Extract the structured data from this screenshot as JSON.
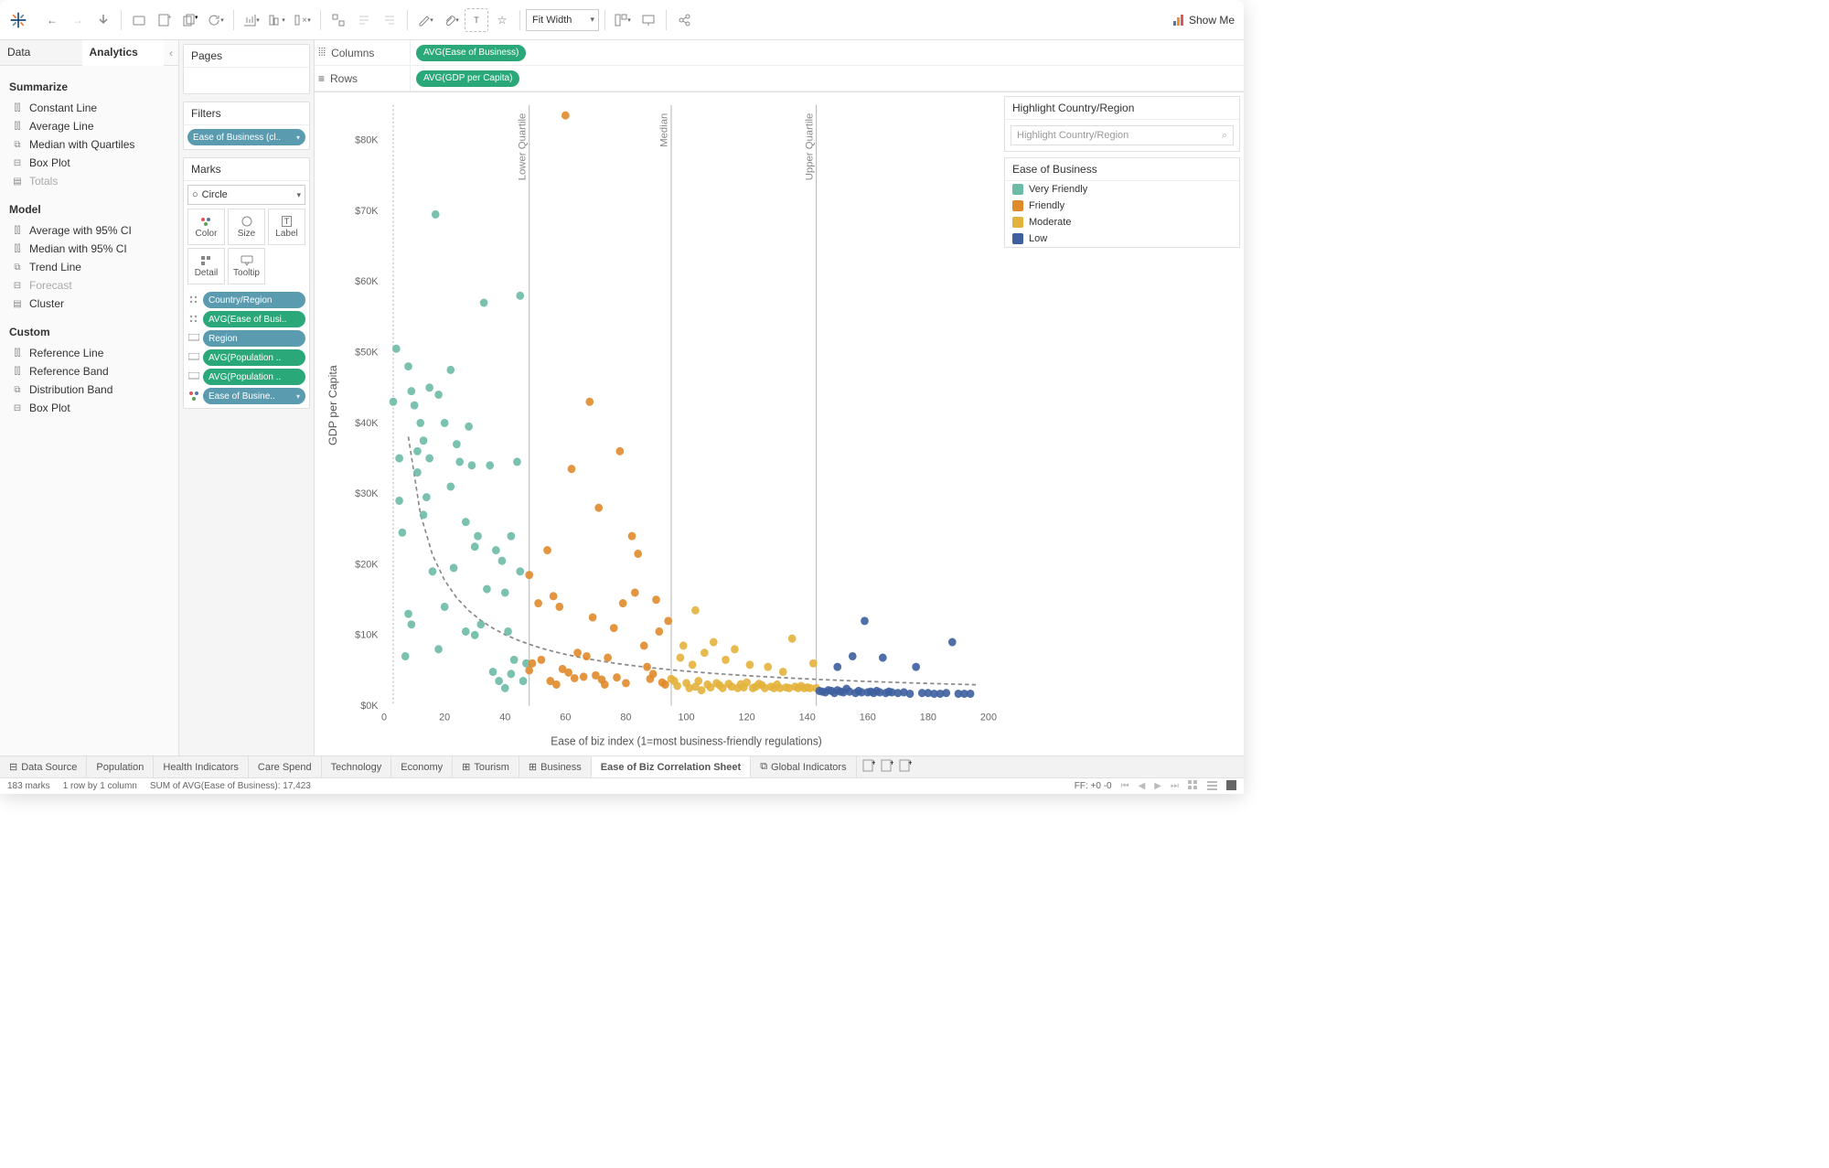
{
  "toolbar": {
    "fit_select": "Fit Width",
    "showme": "Show Me"
  },
  "left_tabs": {
    "data": "Data",
    "analytics": "Analytics"
  },
  "analytics": {
    "summarize": {
      "title": "Summarize",
      "items": [
        "Constant Line",
        "Average Line",
        "Median with Quartiles",
        "Box Plot",
        "Totals"
      ],
      "disabled": [
        4
      ]
    },
    "model": {
      "title": "Model",
      "items": [
        "Average with 95% CI",
        "Median with 95% CI",
        "Trend Line",
        "Forecast",
        "Cluster"
      ],
      "disabled": [
        3
      ]
    },
    "custom": {
      "title": "Custom",
      "items": [
        "Reference Line",
        "Reference Band",
        "Distribution Band",
        "Box Plot"
      ]
    }
  },
  "pages": {
    "title": "Pages"
  },
  "filters": {
    "title": "Filters",
    "pill": "Ease of Business (cl.."
  },
  "marks": {
    "title": "Marks",
    "type": "Circle",
    "cells": [
      "Color",
      "Size",
      "Label",
      "Detail",
      "Tooltip"
    ],
    "pills": [
      {
        "icon": "detail",
        "type": "dim",
        "label": "Country/Region"
      },
      {
        "icon": "detail",
        "type": "meas",
        "label": "AVG(Ease of Busi.."
      },
      {
        "icon": "tooltip",
        "type": "dim",
        "label": "Region"
      },
      {
        "icon": "tooltip",
        "type": "meas",
        "label": "AVG(Population .."
      },
      {
        "icon": "tooltip",
        "type": "meas",
        "label": "AVG(Population .."
      },
      {
        "icon": "color",
        "type": "dim",
        "label": "Ease of Busine.."
      }
    ]
  },
  "shelves": {
    "columns": {
      "label": "Columns",
      "pill": "AVG(Ease of Business)"
    },
    "rows": {
      "label": "Rows",
      "pill": "AVG(GDP per Capita)"
    }
  },
  "highlighter": {
    "title": "Highlight Country/Region",
    "placeholder": "Highlight Country/Region"
  },
  "legend": {
    "title": "Ease of Business",
    "items": [
      {
        "label": "Very Friendly",
        "color": "#6bbba6"
      },
      {
        "label": "Friendly",
        "color": "#e08a2a"
      },
      {
        "label": "Moderate",
        "color": "#e3b23c"
      },
      {
        "label": "Low",
        "color": "#3d5f9e"
      }
    ]
  },
  "chart_data": {
    "type": "scatter",
    "xlabel": "Ease of biz index (1=most business-friendly regulations)",
    "ylabel": "GDP per Capita",
    "xlim": [
      0,
      200
    ],
    "ylim": [
      0,
      85000
    ],
    "xticks": [
      0,
      20,
      40,
      60,
      80,
      100,
      120,
      140,
      160,
      180,
      200
    ],
    "yticks": [
      0,
      10000,
      20000,
      30000,
      40000,
      50000,
      60000,
      70000,
      80000
    ],
    "yticklabels": [
      "$0K",
      "$10K",
      "$20K",
      "$30K",
      "$40K",
      "$50K",
      "$60K",
      "$70K",
      "$80K"
    ],
    "ref_lines": [
      {
        "x": 48,
        "label": "Lower Quartile"
      },
      {
        "x": 95,
        "label": "Median"
      },
      {
        "x": 143,
        "label": "Upper Quartile"
      }
    ],
    "colors": {
      "Very Friendly": "#6bbba6",
      "Friendly": "#e08a2a",
      "Moderate": "#e3b23c",
      "Low": "#3d5f9e"
    },
    "series": [
      {
        "name": "Very Friendly",
        "points": [
          [
            3,
            43000
          ],
          [
            4,
            50500
          ],
          [
            5,
            29000
          ],
          [
            5,
            35000
          ],
          [
            6,
            24500
          ],
          [
            7,
            7000
          ],
          [
            8,
            13000
          ],
          [
            8,
            48000
          ],
          [
            9,
            11500
          ],
          [
            9,
            44500
          ],
          [
            10,
            42500
          ],
          [
            11,
            33000
          ],
          [
            11,
            36000
          ],
          [
            12,
            40000
          ],
          [
            13,
            37500
          ],
          [
            13,
            27000
          ],
          [
            14,
            29500
          ],
          [
            15,
            35000
          ],
          [
            15,
            45000
          ],
          [
            16,
            19000
          ],
          [
            17,
            69500
          ],
          [
            18,
            44000
          ],
          [
            18,
            8000
          ],
          [
            20,
            40000
          ],
          [
            20,
            14000
          ],
          [
            22,
            47500
          ],
          [
            22,
            31000
          ],
          [
            23,
            19500
          ],
          [
            24,
            37000
          ],
          [
            25,
            34500
          ],
          [
            27,
            26000
          ],
          [
            27,
            10500
          ],
          [
            28,
            39500
          ],
          [
            29,
            34000
          ],
          [
            30,
            10000
          ],
          [
            30,
            22500
          ],
          [
            31,
            24000
          ],
          [
            32,
            11500
          ],
          [
            33,
            57000
          ],
          [
            34,
            16500
          ],
          [
            35,
            34000
          ],
          [
            36,
            4800
          ],
          [
            37,
            22000
          ],
          [
            38,
            3500
          ],
          [
            39,
            20500
          ],
          [
            40,
            16000
          ],
          [
            40,
            2500
          ],
          [
            41,
            10500
          ],
          [
            42,
            4500
          ],
          [
            42,
            24000
          ],
          [
            43,
            6500
          ],
          [
            44,
            34500
          ],
          [
            45,
            58000
          ],
          [
            45,
            19000
          ],
          [
            46,
            3500
          ],
          [
            47,
            6000
          ]
        ]
      },
      {
        "name": "Friendly",
        "points": [
          [
            48,
            5000
          ],
          [
            48,
            18500
          ],
          [
            49,
            6000
          ],
          [
            51,
            14500
          ],
          [
            52,
            6500
          ],
          [
            54,
            22000
          ],
          [
            55,
            3500
          ],
          [
            56,
            15500
          ],
          [
            57,
            3000
          ],
          [
            58,
            14000
          ],
          [
            59,
            5200
          ],
          [
            60,
            83500
          ],
          [
            61,
            4700
          ],
          [
            62,
            33500
          ],
          [
            63,
            3900
          ],
          [
            64,
            7500
          ],
          [
            66,
            4100
          ],
          [
            67,
            7000
          ],
          [
            68,
            43000
          ],
          [
            69,
            12500
          ],
          [
            70,
            4300
          ],
          [
            71,
            28000
          ],
          [
            72,
            3700
          ],
          [
            73,
            3000
          ],
          [
            74,
            6800
          ],
          [
            76,
            11000
          ],
          [
            77,
            4000
          ],
          [
            78,
            36000
          ],
          [
            79,
            14500
          ],
          [
            80,
            3200
          ],
          [
            82,
            24000
          ],
          [
            83,
            16000
          ],
          [
            84,
            21500
          ],
          [
            86,
            8500
          ],
          [
            87,
            5500
          ],
          [
            88,
            3800
          ],
          [
            89,
            4500
          ],
          [
            90,
            15000
          ],
          [
            91,
            10500
          ],
          [
            92,
            3300
          ],
          [
            93,
            3000
          ],
          [
            94,
            12000
          ]
        ]
      },
      {
        "name": "Moderate",
        "points": [
          [
            95,
            3800
          ],
          [
            96,
            3500
          ],
          [
            97,
            2800
          ],
          [
            98,
            6800
          ],
          [
            99,
            8500
          ],
          [
            100,
            3200
          ],
          [
            101,
            2500
          ],
          [
            102,
            5800
          ],
          [
            103,
            2700
          ],
          [
            103,
            13500
          ],
          [
            104,
            3500
          ],
          [
            105,
            2200
          ],
          [
            106,
            7500
          ],
          [
            107,
            3000
          ],
          [
            108,
            2600
          ],
          [
            109,
            9000
          ],
          [
            110,
            3200
          ],
          [
            111,
            2900
          ],
          [
            112,
            2500
          ],
          [
            113,
            6500
          ],
          [
            114,
            3100
          ],
          [
            115,
            2700
          ],
          [
            116,
            8000
          ],
          [
            117,
            2500
          ],
          [
            118,
            3050
          ],
          [
            119,
            2600
          ],
          [
            120,
            3300
          ],
          [
            121,
            5800
          ],
          [
            122,
            2500
          ],
          [
            123,
            2700
          ],
          [
            124,
            3100
          ],
          [
            125,
            2900
          ],
          [
            126,
            2500
          ],
          [
            127,
            5500
          ],
          [
            128,
            2700
          ],
          [
            129,
            2500
          ],
          [
            130,
            3000
          ],
          [
            131,
            2500
          ],
          [
            132,
            4800
          ],
          [
            133,
            2600
          ],
          [
            134,
            2500
          ],
          [
            135,
            9500
          ],
          [
            136,
            2700
          ],
          [
            137,
            2500
          ],
          [
            138,
            2800
          ],
          [
            139,
            2500
          ],
          [
            140,
            2600
          ],
          [
            141,
            2500
          ],
          [
            142,
            6000
          ],
          [
            143,
            2500
          ]
        ]
      },
      {
        "name": "Low",
        "points": [
          [
            144,
            2100
          ],
          [
            145,
            2000
          ],
          [
            146,
            1900
          ],
          [
            147,
            2200
          ],
          [
            148,
            2100
          ],
          [
            149,
            1800
          ],
          [
            150,
            5500
          ],
          [
            150,
            2200
          ],
          [
            151,
            2000
          ],
          [
            152,
            1900
          ],
          [
            153,
            2400
          ],
          [
            154,
            2000
          ],
          [
            155,
            7000
          ],
          [
            156,
            1800
          ],
          [
            157,
            2100
          ],
          [
            158,
            1900
          ],
          [
            159,
            12000
          ],
          [
            160,
            1900
          ],
          [
            161,
            2000
          ],
          [
            162,
            1800
          ],
          [
            163,
            2100
          ],
          [
            164,
            1900
          ],
          [
            165,
            6800
          ],
          [
            166,
            1800
          ],
          [
            167,
            2000
          ],
          [
            168,
            1900
          ],
          [
            170,
            1800
          ],
          [
            172,
            1900
          ],
          [
            174,
            1700
          ],
          [
            176,
            5500
          ],
          [
            178,
            1800
          ],
          [
            180,
            1800
          ],
          [
            182,
            1700
          ],
          [
            184,
            1700
          ],
          [
            186,
            1800
          ],
          [
            188,
            9000
          ],
          [
            190,
            1700
          ],
          [
            192,
            1700
          ],
          [
            194,
            1700
          ]
        ]
      }
    ],
    "trend_kind": "power-law-decay"
  },
  "tabs": [
    "Data Source",
    "Population",
    "Health Indicators",
    "Care Spend",
    "Technology",
    "Economy",
    "Tourism",
    "Business",
    "Ease of Biz Correlation Sheet",
    "Global Indicators"
  ],
  "active_tab": 8,
  "tab_icons": {
    "6": "grid",
    "7": "grid",
    "9": "dashboard"
  },
  "status": {
    "marks": "183 marks",
    "rows_cols": "1 row by 1 column",
    "sum": "SUM of AVG(Ease of Business): 17,423",
    "ff": "FF: +0 -0"
  }
}
